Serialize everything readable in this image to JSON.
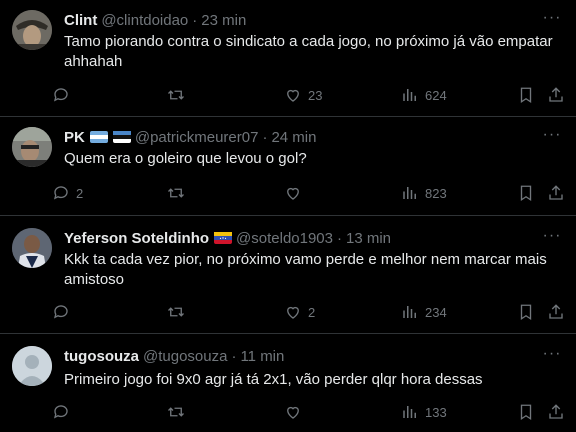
{
  "tweets": [
    {
      "name": "Clint",
      "handle": "@clintdoidao",
      "time": "23 min",
      "text": "Tamo piorando contra o sindicato a cada jogo, no próximo já vão empatar ahhahah",
      "replies": "",
      "retweets": "",
      "likes": "23",
      "views": "624"
    },
    {
      "name": "PK",
      "handle": "@patrickmeurer07",
      "time": "24 min",
      "text": "Quem era o goleiro que levou o gol?",
      "replies": "2",
      "retweets": "",
      "likes": "",
      "views": "823"
    },
    {
      "name": "Yeferson Soteldinho",
      "handle": "@soteldo1903",
      "time": "13 min",
      "text": "Kkk ta cada vez pior, no próximo vamo perde e melhor nem marcar mais amistoso",
      "replies": "",
      "retweets": "",
      "likes": "2",
      "views": "234"
    },
    {
      "name": "tugosouza",
      "handle": "@tugosouza",
      "time": "11 min",
      "text": "Primeiro jogo foi 9x0 agr já tá 2x1, vão perder qlqr hora dessas",
      "replies": "",
      "retweets": "",
      "likes": "",
      "views": "133"
    }
  ],
  "separator": "·",
  "more_label": "···",
  "icons": {
    "reply": "reply-icon",
    "retweet": "retweet-icon",
    "like": "like-icon",
    "views": "views-icon",
    "bookmark": "bookmark-icon",
    "share": "share-icon"
  },
  "colors": {
    "background": "#000000",
    "text": "#e7e9ea",
    "muted": "#71767b",
    "border": "#2f3336"
  }
}
